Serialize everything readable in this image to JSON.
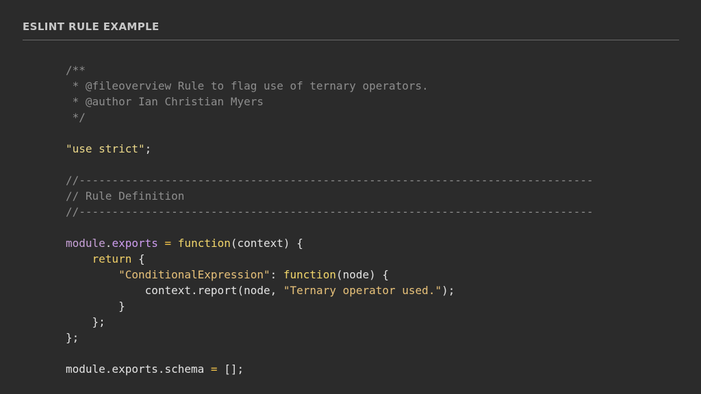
{
  "title": "ESLINT RULE EXAMPLE",
  "code_lines": [
    [
      {
        "c": "t-comment",
        "t": "/**"
      }
    ],
    [
      {
        "c": "t-comment",
        "t": " * @fileoverview Rule to flag use of ternary operators."
      }
    ],
    [
      {
        "c": "t-comment",
        "t": " * @author Ian Christian Myers"
      }
    ],
    [
      {
        "c": "t-comment",
        "t": " */"
      }
    ],
    [],
    [
      {
        "c": "t-string",
        "t": "\"use strict\""
      },
      {
        "c": "t-plain",
        "t": ";"
      }
    ],
    [],
    [
      {
        "c": "t-comment",
        "t": "//------------------------------------------------------------------------------"
      }
    ],
    [
      {
        "c": "t-comment",
        "t": "// Rule Definition"
      }
    ],
    [
      {
        "c": "t-comment",
        "t": "//------------------------------------------------------------------------------"
      }
    ],
    [],
    [
      {
        "c": "t-key",
        "t": "module"
      },
      {
        "c": "t-plain",
        "t": "."
      },
      {
        "c": "t-prop",
        "t": "exports"
      },
      {
        "c": "t-plain",
        "t": " "
      },
      {
        "c": "t-op",
        "t": "="
      },
      {
        "c": "t-plain",
        "t": " "
      },
      {
        "c": "t-fn",
        "t": "function"
      },
      {
        "c": "t-plain",
        "t": "(context) {"
      }
    ],
    [
      {
        "c": "t-plain",
        "t": "    "
      },
      {
        "c": "t-kw",
        "t": "return"
      },
      {
        "c": "t-plain",
        "t": " {"
      }
    ],
    [
      {
        "c": "t-plain",
        "t": "        "
      },
      {
        "c": "t-str2",
        "t": "\"ConditionalExpression\""
      },
      {
        "c": "t-plain",
        "t": ": "
      },
      {
        "c": "t-fn",
        "t": "function"
      },
      {
        "c": "t-plain",
        "t": "(node) {"
      }
    ],
    [
      {
        "c": "t-plain",
        "t": "            context.report(node, "
      },
      {
        "c": "t-str2",
        "t": "\"Ternary operator used.\""
      },
      {
        "c": "t-plain",
        "t": ");"
      }
    ],
    [
      {
        "c": "t-plain",
        "t": "        }"
      }
    ],
    [
      {
        "c": "t-plain",
        "t": "    };"
      }
    ],
    [
      {
        "c": "t-plain",
        "t": "};"
      }
    ],
    [],
    [
      {
        "c": "t-plain",
        "t": "module.exports.schema "
      },
      {
        "c": "t-op",
        "t": "="
      },
      {
        "c": "t-plain",
        "t": " [];"
      }
    ]
  ]
}
